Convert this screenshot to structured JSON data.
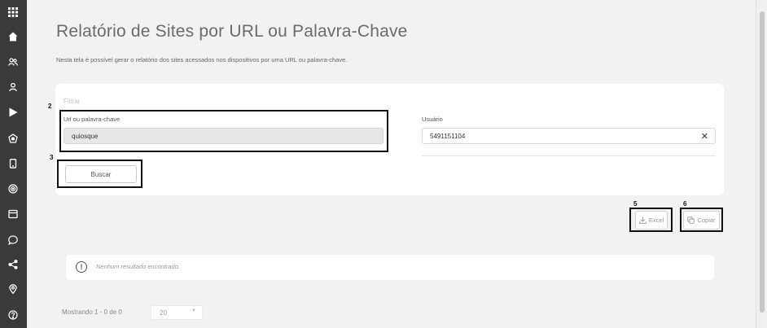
{
  "sidebar": {
    "icons": [
      "apps-grid-icon",
      "home-icon",
      "users-icon",
      "user-icon",
      "play-icon",
      "dashboard-icon",
      "device-icon",
      "target-icon",
      "window-icon",
      "chat-icon",
      "share-icon",
      "location-icon",
      "help-icon"
    ]
  },
  "page": {
    "title": "Relatório de Sites por URL ou Palavra-Chave",
    "description": "Nesta tela é possível gerar o relatório dos sites acessados nos dispositivos por uma URL ou palavra-chave."
  },
  "filter": {
    "section_label": "Filtrar",
    "url_label": "Url ou palavra-chave",
    "url_value": "quiosque",
    "user_label": "Usuário",
    "user_value": "5491151104",
    "clear_symbol": "✕",
    "search_button": "Buscar"
  },
  "export": {
    "excel_label": "Excel",
    "copy_label": "Copiar"
  },
  "annotations": {
    "n2": "2",
    "n3": "3",
    "n5": "5",
    "n6": "6"
  },
  "result": {
    "icon_glyph": "!",
    "message": "Nenhum resultado encontrado."
  },
  "pagination": {
    "showing": "Mostrando 1 - 0 de 0",
    "page_size": "20",
    "chevron": "▼"
  }
}
